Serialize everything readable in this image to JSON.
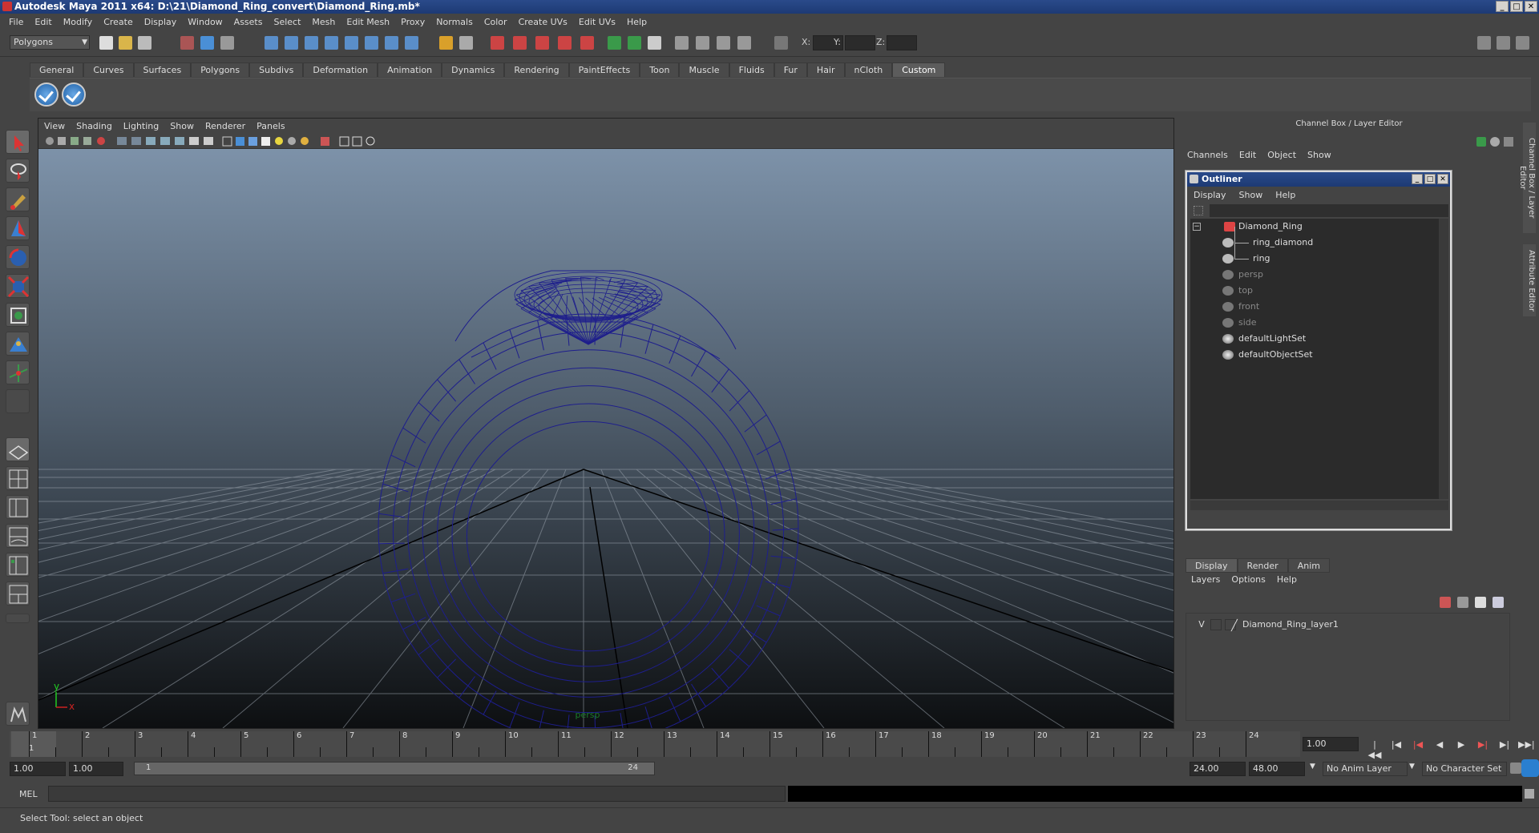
{
  "window": {
    "title": "Autodesk Maya 2011 x64: D:\\21\\Diamond_Ring_convert\\Diamond_Ring.mb*",
    "btn_min": "_",
    "btn_max": "□",
    "btn_close": "✕"
  },
  "menu": [
    "File",
    "Edit",
    "Modify",
    "Create",
    "Display",
    "Window",
    "Assets",
    "Select",
    "Mesh",
    "Edit Mesh",
    "Proxy",
    "Normals",
    "Color",
    "Create UVs",
    "Edit UVs",
    "Help"
  ],
  "status_line": {
    "mode": "Polygons",
    "x_label": "X:",
    "y_label": "Y:",
    "z_label": "Z:"
  },
  "shelf_tabs": [
    "General",
    "Curves",
    "Surfaces",
    "Polygons",
    "Subdivs",
    "Deformation",
    "Animation",
    "Dynamics",
    "Rendering",
    "PaintEffects",
    "Toon",
    "Muscle",
    "Fluids",
    "Fur",
    "Hair",
    "nCloth",
    "Custom"
  ],
  "shelf_active": "Custom",
  "viewport": {
    "menu": [
      "View",
      "Shading",
      "Lighting",
      "Show",
      "Renderer",
      "Panels"
    ],
    "camera_label": "persp",
    "axis_y": "y",
    "axis_x": "x"
  },
  "channel_box": {
    "title": "Channel Box / Layer Editor",
    "menu": [
      "Channels",
      "Edit",
      "Object",
      "Show"
    ]
  },
  "outliner": {
    "title": "Outliner",
    "menu": [
      "Display",
      "Show",
      "Help"
    ],
    "items": [
      {
        "label": "Diamond_Ring",
        "dim": false,
        "indent": 0,
        "expand": "−"
      },
      {
        "label": "ring_diamond",
        "dim": false,
        "indent": 1
      },
      {
        "label": "ring",
        "dim": false,
        "indent": 1
      },
      {
        "label": "persp",
        "dim": true,
        "indent": 0
      },
      {
        "label": "top",
        "dim": true,
        "indent": 0
      },
      {
        "label": "front",
        "dim": true,
        "indent": 0
      },
      {
        "label": "side",
        "dim": true,
        "indent": 0
      },
      {
        "label": "defaultLightSet",
        "dim": false,
        "indent": 0
      },
      {
        "label": "defaultObjectSet",
        "dim": false,
        "indent": 0
      }
    ]
  },
  "layer_editor": {
    "tabs": [
      "Display",
      "Render",
      "Anim"
    ],
    "active_tab": "Display",
    "menu": [
      "Layers",
      "Options",
      "Help"
    ],
    "layers": [
      {
        "visible": "V",
        "name": "Diamond_Ring_layer1"
      }
    ]
  },
  "side_tabs": [
    "Channel Box / Layer Editor",
    "Attribute Editor"
  ],
  "timeline": {
    "frames": [
      "1",
      "2",
      "3",
      "4",
      "5",
      "6",
      "7",
      "8",
      "9",
      "10",
      "11",
      "12",
      "13",
      "14",
      "15",
      "16",
      "17",
      "18",
      "19",
      "20",
      "21",
      "22",
      "23",
      "24"
    ],
    "current_frame": "1",
    "current_time_field": "1.00"
  },
  "range": {
    "start": "1.00",
    "playback_start": "1.00",
    "slider_start": "1",
    "slider_end": "24",
    "playback_end": "24.00",
    "end": "48.00",
    "anim_layer": "No Anim Layer",
    "character_set": "No Character Set"
  },
  "command_line": {
    "label": "MEL"
  },
  "help_line": "Select Tool: select an object"
}
